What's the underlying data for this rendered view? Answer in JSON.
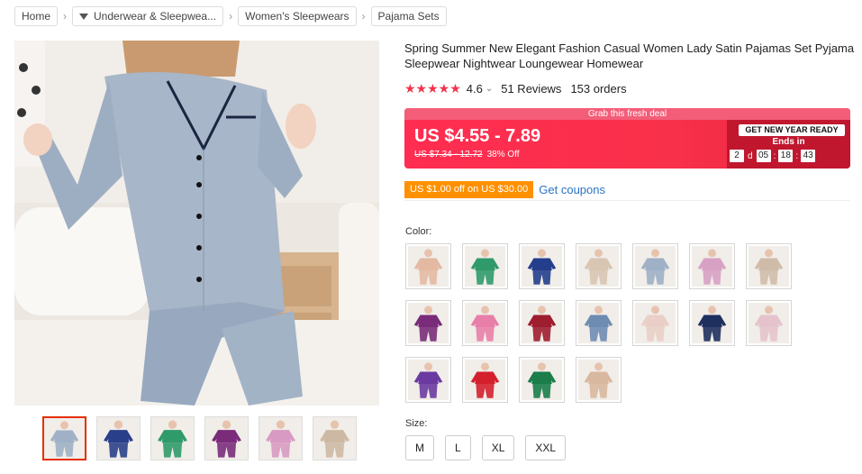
{
  "breadcrumb": [
    {
      "label": "Home",
      "has_icon": false
    },
    {
      "label": "Underwear & Sleepwea...",
      "has_icon": true
    },
    {
      "label": "Women's Sleepwears",
      "has_icon": false
    },
    {
      "label": "Pajama Sets",
      "has_icon": false
    }
  ],
  "breadcrumb_separator": "›",
  "product": {
    "title": "Spring Summer New Elegant Fashion Casual Women Lady Satin Pajamas Set Pyjama Sleepwear Nightwear Loungewear Homewear",
    "rating": "4.6",
    "rating_chevron": "⌄",
    "stars": "★★★★★",
    "reviews": "51 Reviews",
    "orders": "153 orders"
  },
  "deal": {
    "banner": "Grab this fresh deal",
    "price": "US $4.55 - 7.89",
    "original_price": "US $7.34 - 12.72",
    "discount": "38% Off",
    "promo_badge": "GET NEW YEAR READY",
    "ends_label": "Ends in",
    "days": "2",
    "days_unit": "d",
    "hours": "05",
    "minutes": "18",
    "seconds": "43",
    "colon": ":"
  },
  "coupon": {
    "tag": "US $1.00 off on US $30.00",
    "link": "Get coupons"
  },
  "color_label": "Color:",
  "size_label": "Size:",
  "sizes": [
    "M",
    "L",
    "XL",
    "XXL"
  ],
  "colors": {
    "accent_red": "#f2334a",
    "deal_dark": "#c0172f",
    "coupon_orange": "#ff9000",
    "link_blue": "#2a74c4",
    "thumb_active": "#e62e04"
  },
  "swatches": [
    {
      "name": "nude",
      "color": "#e3b9a2"
    },
    {
      "name": "green-dots",
      "color": "#2f9a6a"
    },
    {
      "name": "navy",
      "color": "#243e8c"
    },
    {
      "name": "champagne",
      "color": "#d8c5b2"
    },
    {
      "name": "grey-blue",
      "color": "#9fb0c7"
    },
    {
      "name": "pink-lilac",
      "color": "#d7a1c4"
    },
    {
      "name": "beige",
      "color": "#cfbca8"
    },
    {
      "name": "purple",
      "color": "#7a2c7a"
    },
    {
      "name": "pink",
      "color": "#e87fa8"
    },
    {
      "name": "wine",
      "color": "#9e1d2f"
    },
    {
      "name": "blue-grey-short",
      "color": "#6e8cb2"
    },
    {
      "name": "light-pink-short",
      "color": "#e9cfc8"
    },
    {
      "name": "navy-short",
      "color": "#1f2f5e"
    },
    {
      "name": "blush-short",
      "color": "#e5c3cc"
    },
    {
      "name": "violet-short",
      "color": "#6a3aa1"
    },
    {
      "name": "red-short",
      "color": "#d4202d"
    },
    {
      "name": "emerald-short",
      "color": "#1a7d4a"
    },
    {
      "name": "tan-short",
      "color": "#d9b8a0"
    }
  ],
  "thumbnails": [
    {
      "name": "grey-blue",
      "color": "#9fb0c7"
    },
    {
      "name": "navy",
      "color": "#2a3f8a"
    },
    {
      "name": "green",
      "color": "#2f9a6a"
    },
    {
      "name": "purple",
      "color": "#7a2c7a"
    },
    {
      "name": "pink",
      "color": "#d89ac2"
    },
    {
      "name": "champagne",
      "color": "#cdb9a3"
    }
  ]
}
